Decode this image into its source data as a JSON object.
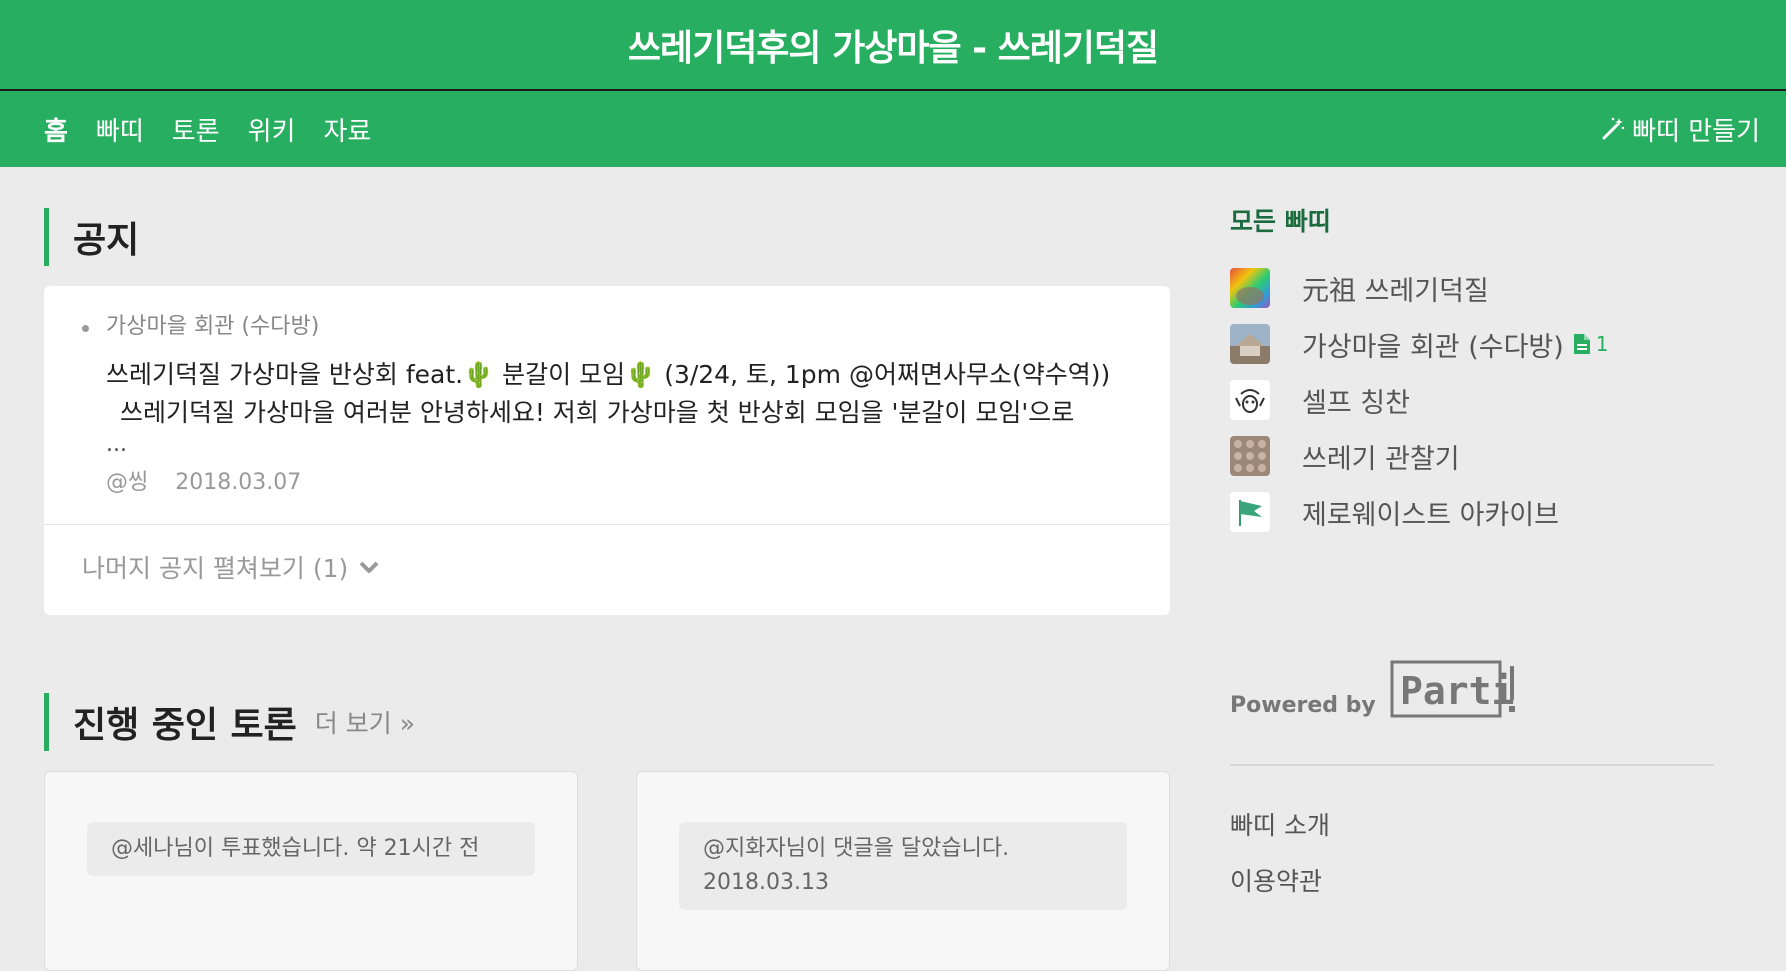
{
  "header": {
    "title": "쓰레기덕후의 가상마을 - 쓰레기덕질"
  },
  "nav": {
    "items": [
      {
        "label": "홈",
        "active": true
      },
      {
        "label": "빠띠"
      },
      {
        "label": "토론"
      },
      {
        "label": "위키"
      },
      {
        "label": "자료"
      }
    ],
    "make_label": "빠띠 만들기"
  },
  "notice": {
    "section_title": "공지",
    "item": {
      "board": "가상마을 회관 (수다방)",
      "title": "쓰레기덕질 가상마을 반상회 feat.🌵  분갈이 모임🌵 (3/24, 토, 1pm @어쩌면사무소(약수역))",
      "excerpt": "쓰레기덕질 가상마을 여러분 안녕하세요!  저희 가상마을 첫 반상회 모임을 '분갈이 모임'으로",
      "ellipsis": "...",
      "author": "@씽",
      "date": "2018.03.07"
    },
    "more_label": "나머지 공지 펼쳐보기 (1)"
  },
  "discussions": {
    "section_title": "진행 중인 토론",
    "more_label": "더 보기 »",
    "cards": [
      {
        "activity": "@세나님이 투표했습니다. 약 21시간 전"
      },
      {
        "activity": "@지화자님이 댓글을 달았습니다. 2018.03.13"
      }
    ]
  },
  "sidebar": {
    "title": "모든 빠띠",
    "boards": [
      {
        "name": "元祖 쓰레기덕질",
        "icon": "rainbow-thumbnail"
      },
      {
        "name": "가상마을 회관 (수다방)",
        "icon": "building-thumbnail",
        "doc_count": "1"
      },
      {
        "name": "셀프 칭찬",
        "icon": "face-thumbnail"
      },
      {
        "name": "쓰레기 관찰기",
        "icon": "pattern-thumbnail"
      },
      {
        "name": "제로웨이스트 아카이브",
        "icon": "flag-thumbnail"
      }
    ],
    "powered_by": "Powered by",
    "logo_text": "Parti",
    "footer_links": [
      "빠띠 소개",
      "이용약관"
    ]
  },
  "colors": {
    "brand_green": "#27ae60",
    "sidebar_title": "#1b6b3f"
  }
}
